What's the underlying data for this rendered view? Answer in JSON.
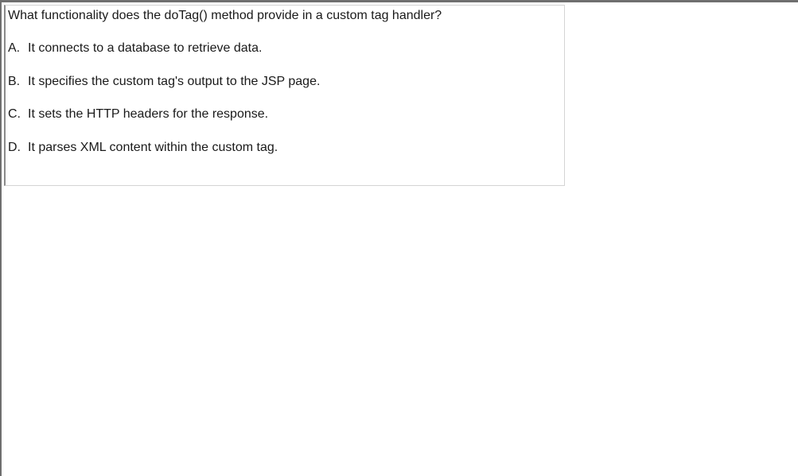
{
  "question": {
    "text": "What functionality does the doTag() method provide in a custom tag handler?"
  },
  "options": [
    {
      "letter": "A.",
      "text": "It connects to a database to retrieve data."
    },
    {
      "letter": "B.",
      "text": "It specifies the custom tag's output to the JSP page."
    },
    {
      "letter": "C.",
      "text": "It sets the HTTP headers for the response."
    },
    {
      "letter": "D.",
      "text": "It parses XML content within the custom tag."
    }
  ],
  "colors": {
    "text": "#1a1a1a",
    "panel_border": "#d4d4d4",
    "window_border": "#6f6f6f",
    "background": "#ffffff"
  }
}
